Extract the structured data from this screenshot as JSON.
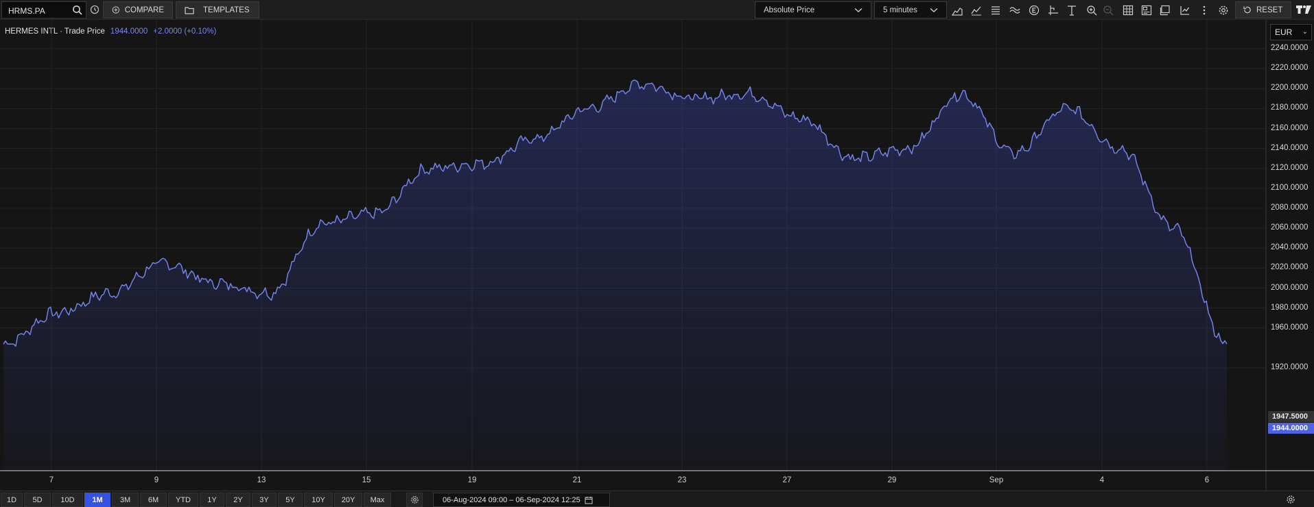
{
  "toolbar": {
    "symbol": "HRMS.PA",
    "compare_label": "COMPARE",
    "templates_label": "TEMPLATES",
    "price_mode": "Absolute Price",
    "interval": "5 minutes",
    "reset_label": "RESET",
    "icons": [
      "search-icon",
      "history-icon",
      "compare-plus-icon",
      "folder-icon",
      "chart-type-icon",
      "indicators-icon",
      "lines-icon",
      "studies-icon",
      "events-icon",
      "crosshair-icon",
      "text-icon",
      "zoom-in-icon",
      "zoom-out-icon",
      "table-icon",
      "layout-icon",
      "export-icon",
      "analytics-icon",
      "more-vert-icon",
      "settings-gear-icon",
      "reset-icon",
      "tradingview-logo"
    ]
  },
  "legend": {
    "name": "HERMES INTL · Trade Price",
    "last": "1944.0000",
    "change": "+2.0000 (+0.10%)"
  },
  "currency": "EUR",
  "price_tags": {
    "last_close": "1947.5000",
    "current": "1944.0000"
  },
  "chart_data": {
    "type": "area",
    "series": [
      {
        "name": "HERMES INTL · Trade Price",
        "color": "#7083ea"
      }
    ],
    "x": [
      "Aug 6 09:00",
      "Aug 7",
      "Aug 8",
      "Aug 9",
      "Aug 12",
      "Aug 13",
      "Aug 14",
      "Aug 15",
      "Aug 16",
      "Aug 19",
      "Aug 20",
      "Aug 21",
      "Aug 22",
      "Aug 23",
      "Aug 26",
      "Aug 27",
      "Aug 28",
      "Aug 29",
      "Aug 30",
      "Sep 2",
      "Sep 3",
      "Sep 4",
      "Sep 5",
      "Sep 6 12:25"
    ],
    "values": [
      1944,
      1975,
      1995,
      2025,
      2005,
      1995,
      2065,
      2075,
      2120,
      2125,
      2150,
      2180,
      2205,
      2190,
      2195,
      2170,
      2130,
      2140,
      2195,
      2135,
      2180,
      2140,
      2060,
      1944
    ],
    "ylim": [
      1905,
      2250
    ],
    "yticks": [
      "2240.0000",
      "2220.0000",
      "2200.0000",
      "2180.0000",
      "2160.0000",
      "2140.0000",
      "2120.0000",
      "2100.0000",
      "2080.0000",
      "2060.0000",
      "2040.0000",
      "2020.0000",
      "2000.0000",
      "1980.0000",
      "1960.0000",
      "1920.0000"
    ],
    "xticks": [
      "7",
      "9",
      "13",
      "15",
      "19",
      "21",
      "23",
      "27",
      "29",
      "Sep",
      "4",
      "6"
    ],
    "grid": true,
    "currency": "EUR"
  },
  "bottom": {
    "periods": [
      "1D",
      "5D",
      "10D",
      "1M",
      "3M",
      "6M",
      "YTD",
      "1Y",
      "2Y",
      "3Y",
      "5Y",
      "10Y",
      "20Y",
      "Max"
    ],
    "active_period": "1M",
    "range_text": "06-Aug-2024 09:00  –  06-Sep-2024 12:25"
  }
}
